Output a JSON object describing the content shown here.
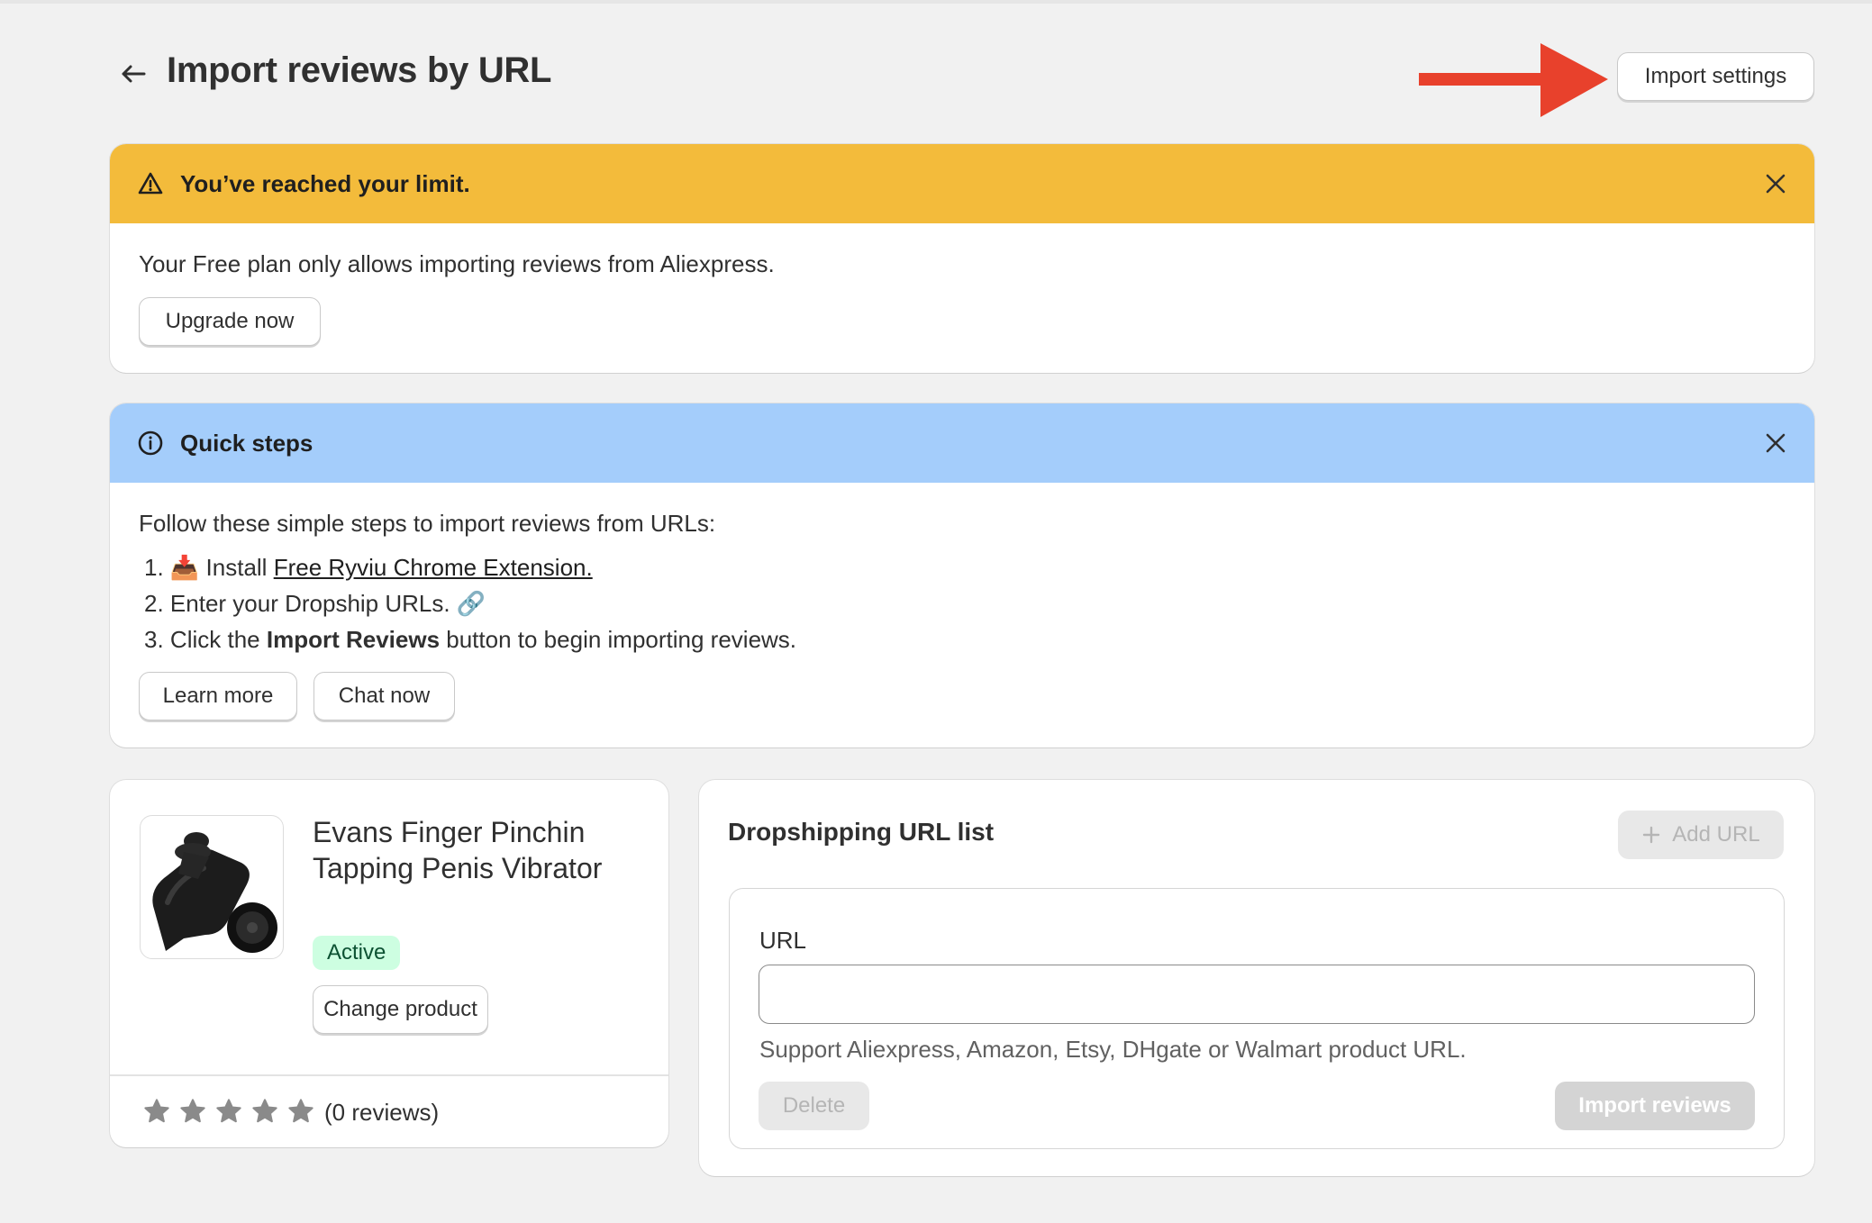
{
  "header": {
    "title": "Import reviews by URL",
    "import_settings_label": "Import settings"
  },
  "limit_banner": {
    "title": "You’ve reached your limit.",
    "message": "Your Free plan only allows importing reviews from Aliexpress.",
    "upgrade_label": "Upgrade now"
  },
  "quick_steps": {
    "title": "Quick steps",
    "intro": "Follow these simple steps to import reviews from URLs:",
    "step1_number": "1.",
    "step1_emoji": "📥",
    "step1_text": "Install",
    "step1_link": "Free Ryviu Chrome Extension.",
    "step2_number": "2.",
    "step2_text": "Enter your Dropship URLs.",
    "step2_emoji": "🔗",
    "step3_number": "3.",
    "step3_pre": "Click the",
    "step3_bold": "Import Reviews",
    "step3_post": "button to begin importing reviews.",
    "learn_more_label": "Learn more",
    "chat_now_label": "Chat now"
  },
  "product": {
    "name": "Evans Finger Pinchin Tapping Penis Vibrator",
    "status": "Active",
    "change_label": "Change product",
    "rating_stars": 5,
    "reviews_text": "(0 reviews)"
  },
  "url_list": {
    "title": "Dropshipping URL list",
    "add_url_label": "Add URL",
    "url_label": "URL",
    "url_value": "",
    "help_text": "Support Aliexpress, Amazon, Etsy, DHgate or Walmart product URL.",
    "delete_label": "Delete",
    "import_label": "Import reviews"
  },
  "colors": {
    "warning_banner": "#f3bb3b",
    "info_banner": "#a4cdfb",
    "annotation_arrow": "#e8412c",
    "active_badge_bg": "#cdfee1"
  }
}
